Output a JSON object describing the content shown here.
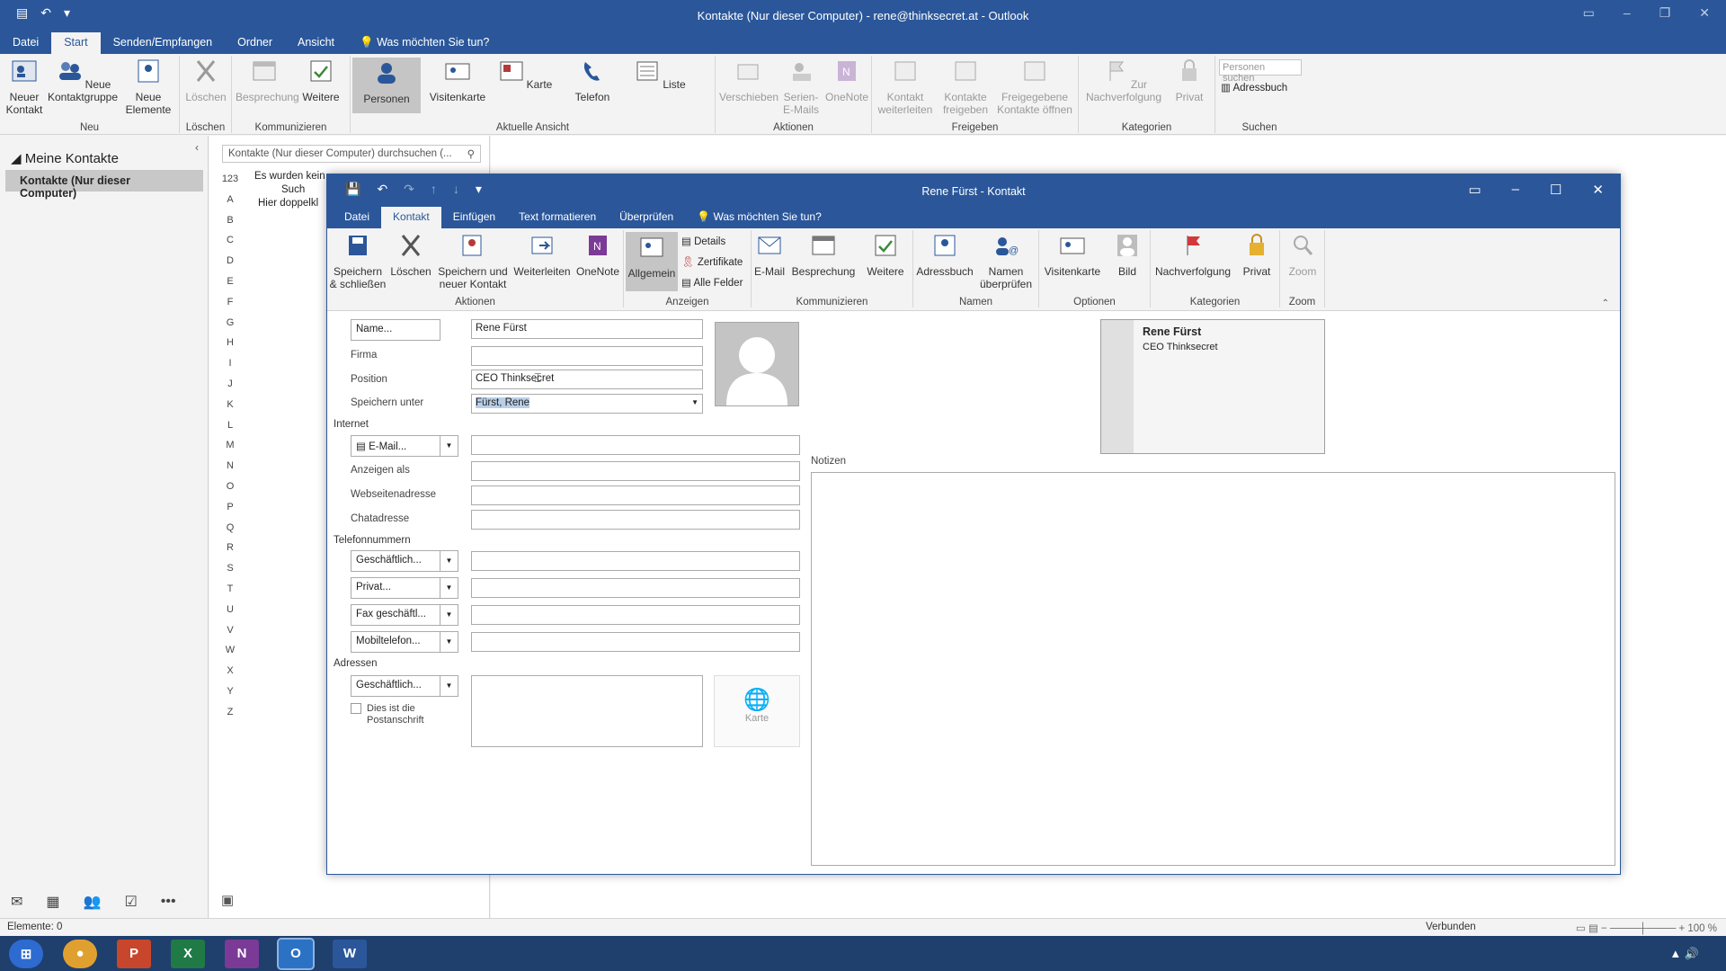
{
  "app": {
    "title": "Kontakte (Nur dieser Computer) - rene@thinksecret.at - Outlook",
    "tabs": [
      "Datei",
      "Start",
      "Senden/Empfangen",
      "Ordner",
      "Ansicht"
    ],
    "tell_me": "Was möchten Sie tun?"
  },
  "ribbon": {
    "neu": {
      "label": "Neu",
      "new_contact": "Neuer Kontakt",
      "new_group": "Neue Kontaktgruppe",
      "new_items": "Neue Elemente"
    },
    "loeschen": {
      "label": "Löschen",
      "delete": "Löschen"
    },
    "kommunizieren": {
      "label": "Kommunizieren",
      "meeting": "Besprechung",
      "more": "Weitere"
    },
    "ansicht": {
      "label": "Aktuelle Ansicht",
      "personen": "Personen",
      "visitenkarte": "Visitenkarte",
      "karte": "Karte",
      "telefon": "Telefon",
      "liste": "Liste"
    },
    "aktionen": {
      "label": "Aktionen",
      "move": "Verschieben",
      "mailmerge": "Serien-E-Mails",
      "onenote": "OneNote"
    },
    "freigeben": {
      "label": "Freigeben",
      "forward": "Kontakt weiterleiten",
      "share": "Kontakte freigeben",
      "open_shared": "Freigegebene Kontakte öffnen"
    },
    "kategorien": {
      "label": "Kategorien",
      "followup": "Zur Nachverfolgung",
      "private": "Privat"
    },
    "suchen": {
      "label": "Suchen",
      "search_people": "Personen suchen",
      "addressbook": "Adressbuch"
    }
  },
  "nav": {
    "header": "Meine Kontakte",
    "selected": "Kontakte (Nur dieser Computer)"
  },
  "list": {
    "search_placeholder": "Kontakte (Nur dieser Computer) durchsuchen (...",
    "message_line1": "Es wurden kein",
    "message_line2": "Such",
    "message_line3": "Hier doppelkl",
    "alphabet": [
      "123",
      "A",
      "B",
      "C",
      "D",
      "E",
      "F",
      "G",
      "H",
      "I",
      "J",
      "K",
      "L",
      "M",
      "N",
      "O",
      "P",
      "Q",
      "R",
      "S",
      "T",
      "U",
      "V",
      "W",
      "X",
      "Y",
      "Z"
    ]
  },
  "status": {
    "items": "Elemente: 0",
    "connection": "Verbunden",
    "zoom": "100 %"
  },
  "contact": {
    "window_title": "Rene Fürst - Kontakt",
    "tabs": [
      "Datei",
      "Kontakt",
      "Einfügen",
      "Text formatieren",
      "Überprüfen"
    ],
    "tell_me": "Was möchten Sie tun?",
    "ribbon": {
      "aktionen": {
        "label": "Aktionen",
        "save_close": "Speichern & schließen",
        "delete": "Löschen",
        "save_new": "Speichern und neuer Kontakt",
        "forward": "Weiterleiten",
        "onenote": "OneNote"
      },
      "anzeigen": {
        "label": "Anzeigen",
        "general": "Allgemein",
        "details": "Details",
        "certs": "Zertifikate",
        "all_fields": "Alle Felder"
      },
      "kommunizieren": {
        "label": "Kommunizieren",
        "email": "E-Mail",
        "meeting": "Besprechung",
        "more": "Weitere"
      },
      "namen": {
        "label": "Namen",
        "addressbook": "Adressbuch",
        "check": "Namen überprüfen"
      },
      "optionen": {
        "label": "Optionen",
        "card": "Visitenkarte",
        "picture": "Bild"
      },
      "kategorien": {
        "label": "Kategorien",
        "followup": "Nachverfolgung",
        "private": "Privat"
      },
      "zoom": {
        "label": "Zoom",
        "zoom": "Zoom"
      }
    },
    "form": {
      "name_btn": "Name...",
      "name_val": "Rene Fürst",
      "firma_lbl": "Firma",
      "firma_val": "",
      "position_lbl": "Position",
      "position_val": "CEO Thinksecret",
      "saveas_lbl": "Speichern unter",
      "saveas_val": "Fürst, Rene",
      "internet_lbl": "Internet",
      "email_btn": "E-Mail...",
      "display_lbl": "Anzeigen als",
      "web_lbl": "Webseitenadresse",
      "chat_lbl": "Chatadresse",
      "phones_lbl": "Telefonnummern",
      "phone1": "Geschäftlich...",
      "phone2": "Privat...",
      "phone3": "Fax geschäftl...",
      "phone4": "Mobiltelefon...",
      "address_lbl": "Adressen",
      "address_btn": "Geschäftlich...",
      "postal_line1": "Dies ist die",
      "postal_line2": "Postanschrift",
      "map_btn": "Karte",
      "notes_lbl": "Notizen"
    },
    "card": {
      "name": "Rene Fürst",
      "position": "CEO Thinksecret"
    }
  }
}
